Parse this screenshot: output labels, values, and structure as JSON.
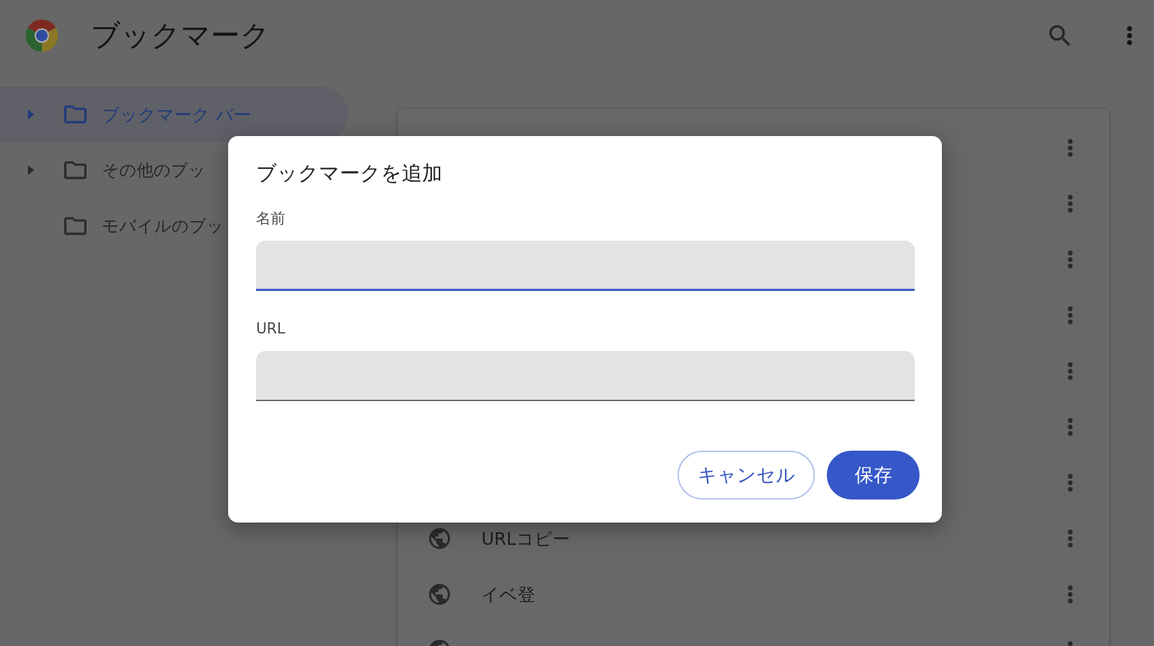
{
  "header": {
    "title": "ブックマーク"
  },
  "sidebar": {
    "items": [
      {
        "label": "ブックマーク バー",
        "selected": true,
        "expandable": true
      },
      {
        "label": "その他のブッ",
        "selected": false,
        "expandable": true
      },
      {
        "label": "モバイルのブッ",
        "selected": false,
        "expandable": false
      }
    ]
  },
  "bookmark_list": {
    "rows": [
      {
        "kind": "covered"
      },
      {
        "kind": "covered"
      },
      {
        "kind": "covered"
      },
      {
        "kind": "covered"
      },
      {
        "kind": "covered"
      },
      {
        "kind": "covered"
      },
      {
        "kind": "covered"
      },
      {
        "kind": "bookmark",
        "title": "URLコピー"
      },
      {
        "kind": "bookmark",
        "title": "イベ登"
      },
      {
        "kind": "bookmark"
      }
    ]
  },
  "dialog": {
    "title": "ブックマークを追加",
    "fields": [
      {
        "label": "名前",
        "focused": true
      },
      {
        "label": "URL",
        "focused": false
      }
    ],
    "buttons": [
      {
        "label": "キャンセル",
        "kind": "outlined"
      },
      {
        "label": "保存",
        "kind": "filled"
      }
    ]
  }
}
